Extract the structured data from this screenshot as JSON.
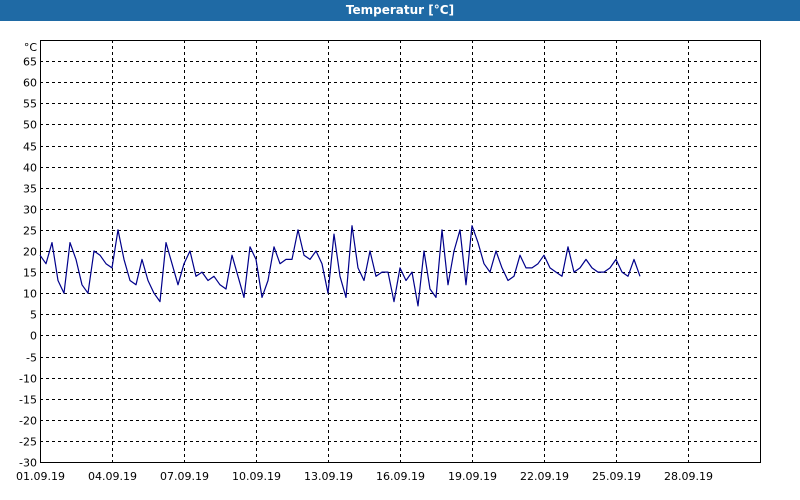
{
  "window": {
    "title": "Temperatur [°C]"
  },
  "chart_data": {
    "type": "line",
    "title": "Temperatur [°C]",
    "unit_label": "°C",
    "ylim": [
      -30,
      70
    ],
    "xlim_days": [
      0,
      30
    ],
    "y_ticks": [
      65,
      60,
      55,
      50,
      45,
      40,
      35,
      30,
      25,
      20,
      15,
      10,
      5,
      0,
      -5,
      -10,
      -15,
      -20,
      -25,
      -30
    ],
    "x_ticks": [
      "01.09.19",
      "04.09.19",
      "07.09.19",
      "10.09.19",
      "13.09.19",
      "16.09.19",
      "19.09.19",
      "22.09.19",
      "25.09.19",
      "28.09.19"
    ],
    "grid": true,
    "colors": {
      "line": "#00008b",
      "grid": "#000000",
      "title_bar": "#1f6aa5"
    },
    "series": [
      {
        "x_start": "01.09.19",
        "x_step_days": 0.25,
        "values": [
          19,
          17,
          22,
          13,
          10,
          22,
          18,
          12,
          10,
          20,
          19,
          17,
          16,
          25,
          18,
          13,
          12,
          18,
          13,
          10,
          8,
          22,
          17,
          12,
          17,
          20,
          14,
          15,
          13,
          14,
          12,
          11,
          19,
          14,
          9,
          21,
          18,
          9,
          13,
          21,
          17,
          18,
          18,
          25,
          19,
          18,
          20,
          17,
          10,
          24,
          14,
          9,
          26,
          16,
          13,
          20,
          14,
          15,
          15,
          8,
          16,
          13,
          15,
          7,
          20,
          11,
          9,
          25,
          12,
          20,
          25,
          12,
          26,
          22,
          17,
          15,
          20,
          16,
          13,
          14,
          19,
          16,
          16,
          17,
          19,
          16,
          15,
          14,
          21,
          15,
          16,
          18,
          16,
          15,
          15,
          16,
          18,
          15,
          14,
          18,
          14
        ]
      }
    ]
  }
}
